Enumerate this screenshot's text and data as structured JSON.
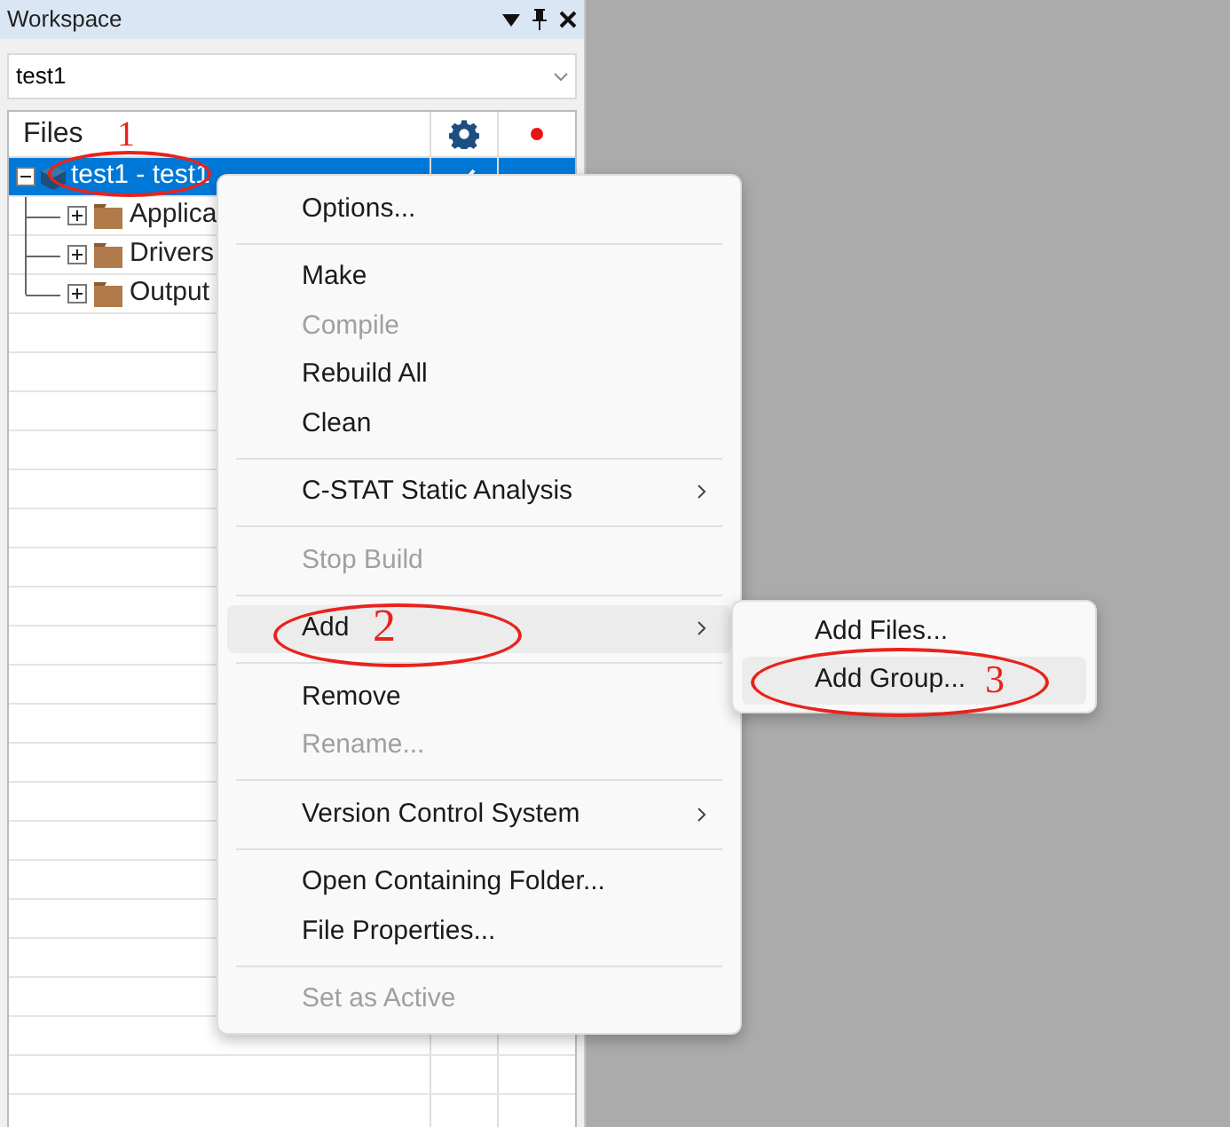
{
  "panel": {
    "title": "Workspace"
  },
  "configuration": {
    "value": "test1"
  },
  "tree": {
    "column": "Files",
    "nodes": [
      {
        "label": "test1 - test1",
        "selected": true,
        "expanded": true,
        "checked": true,
        "children": [
          {
            "label": "Applica",
            "selected": false,
            "expanded": false
          },
          {
            "label": "Drivers",
            "selected": false,
            "expanded": false
          },
          {
            "label": "Output",
            "selected": false,
            "expanded": false
          }
        ]
      }
    ]
  },
  "context_menu": {
    "items": [
      {
        "kind": "item",
        "label": "Options...",
        "disabled": false,
        "selected": false,
        "submenu": false
      },
      {
        "kind": "separator"
      },
      {
        "kind": "item",
        "label": "Make",
        "disabled": false,
        "selected": false,
        "submenu": false
      },
      {
        "kind": "item",
        "label": "Compile",
        "disabled": true,
        "selected": false,
        "submenu": false
      },
      {
        "kind": "item",
        "label": "Rebuild All",
        "disabled": false,
        "selected": false,
        "submenu": false
      },
      {
        "kind": "item",
        "label": "Clean",
        "disabled": false,
        "selected": false,
        "submenu": false
      },
      {
        "kind": "separator"
      },
      {
        "kind": "item",
        "label": "C-STAT Static Analysis",
        "disabled": false,
        "selected": false,
        "submenu": true
      },
      {
        "kind": "separator"
      },
      {
        "kind": "item",
        "label": "Stop Build",
        "disabled": true,
        "selected": false,
        "submenu": false
      },
      {
        "kind": "separator"
      },
      {
        "kind": "item",
        "label": "Add",
        "disabled": false,
        "selected": true,
        "submenu": true
      },
      {
        "kind": "separator"
      },
      {
        "kind": "item",
        "label": "Remove",
        "disabled": false,
        "selected": false,
        "submenu": false
      },
      {
        "kind": "item",
        "label": "Rename...",
        "disabled": true,
        "selected": false,
        "submenu": false
      },
      {
        "kind": "separator"
      },
      {
        "kind": "item",
        "label": "Version Control System",
        "disabled": false,
        "selected": false,
        "submenu": true
      },
      {
        "kind": "separator"
      },
      {
        "kind": "item",
        "label": "Open Containing Folder...",
        "disabled": false,
        "selected": false,
        "submenu": false
      },
      {
        "kind": "item",
        "label": "File Properties...",
        "disabled": false,
        "selected": false,
        "submenu": false
      },
      {
        "kind": "separator"
      },
      {
        "kind": "item",
        "label": "Set as Active",
        "disabled": true,
        "selected": false,
        "submenu": false
      }
    ]
  },
  "submenu": {
    "items": [
      {
        "label": "Add Files...",
        "selected": false
      },
      {
        "label": "Add Group...",
        "selected": true
      }
    ]
  },
  "annotations": [
    {
      "label": "1"
    },
    {
      "label": "2"
    },
    {
      "label": "3"
    }
  ]
}
